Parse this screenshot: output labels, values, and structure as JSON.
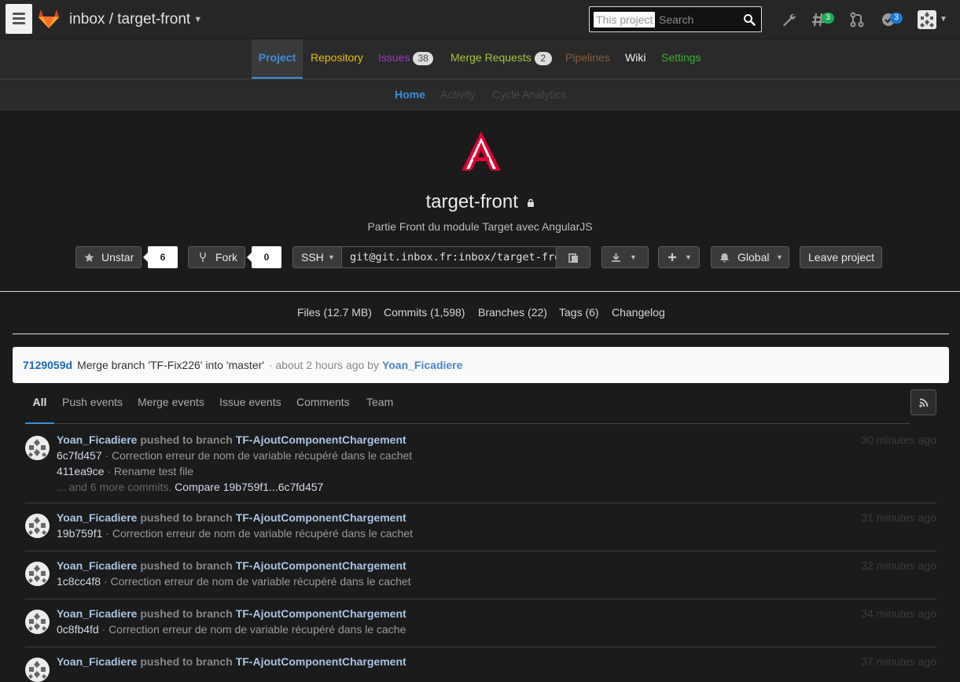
{
  "header": {
    "project_path": "inbox / target-front",
    "search_scope": "This project",
    "search_placeholder": "Search",
    "todos_count": "3",
    "issues_count": "3"
  },
  "nav": {
    "items": [
      {
        "label": "Project",
        "color": "#3b8fd9"
      },
      {
        "label": "Repository",
        "color": "#e5c100"
      },
      {
        "label": "Issues",
        "count": "38",
        "color": "#9f32d0"
      },
      {
        "label": "Merge Requests",
        "count": "2",
        "color": "#a4c639"
      },
      {
        "label": "Pipelines",
        "color": "#8b5a3c"
      },
      {
        "label": "Wiki",
        "color": "#f0f0f0"
      },
      {
        "label": "Settings",
        "color": "#3eae38"
      }
    ],
    "sub_items": [
      {
        "label": "Home",
        "color": "#3b8fd9"
      },
      {
        "label": "Activity",
        "color": "#4a4a4a"
      },
      {
        "label": "Cycle Analytics",
        "color": "#4a4a4a"
      }
    ]
  },
  "project": {
    "name": "target-front",
    "description": "Partie Front du module Target avec AngularJS",
    "star_label": "Unstar",
    "star_count": "6",
    "fork_label": "Fork",
    "fork_count": "0",
    "protocol": "SSH",
    "clone_url": "git@git.inbox.fr:inbox/target-front.git",
    "notification_label": "Global",
    "leave_label": "Leave project"
  },
  "stats": {
    "files": "Files (12.7 MB)",
    "commits": "Commits (1,598)",
    "branches": "Branches (22)",
    "tags": "Tags (6)",
    "changelog": "Changelog"
  },
  "last_commit": {
    "sha": "7129059d",
    "message": "Merge branch 'TF-Fix226' into 'master'",
    "meta": "· about 2 hours ago by",
    "author": "Yoan_Ficadiere"
  },
  "event_tabs": [
    "All",
    "Push events",
    "Merge events",
    "Issue events",
    "Comments",
    "Team"
  ],
  "events": [
    {
      "user": "Yoan_Ficadiere",
      "action": "pushed to branch",
      "branch": "TF-AjoutComponentChargement",
      "time": "30 minutes ago",
      "commits": [
        {
          "sha": "6c7fd457",
          "msg": "Correction erreur de nom de variable récupéré dans le cachet"
        },
        {
          "sha": "411ea9ce",
          "msg": "Rename test file"
        }
      ],
      "more": "... and 6 more commits.",
      "compare": "Compare 19b759f1...6c7fd457"
    },
    {
      "user": "Yoan_Ficadiere",
      "action": "pushed to branch",
      "branch": "TF-AjoutComponentChargement",
      "time": "31 minutes ago",
      "commits": [
        {
          "sha": "19b759f1",
          "msg": "Correction erreur de nom de variable récupéré dans le cachet"
        }
      ]
    },
    {
      "user": "Yoan_Ficadiere",
      "action": "pushed to branch",
      "branch": "TF-AjoutComponentChargement",
      "time": "32 minutes ago",
      "commits": [
        {
          "sha": "1c8cc4f8",
          "msg": "Correction erreur de nom de variable récupéré dans le cachet"
        }
      ]
    },
    {
      "user": "Yoan_Ficadiere",
      "action": "pushed to branch",
      "branch": "TF-AjoutComponentChargement",
      "time": "34 minutes ago",
      "commits": [
        {
          "sha": "0c8fb4fd",
          "msg": "Correction erreur de nom de variable récupéré dans le cache"
        }
      ]
    },
    {
      "user": "Yoan_Ficadiere",
      "action": "pushed to branch",
      "branch": "TF-AjoutComponentChargement",
      "time": "37 minutes ago",
      "commits": []
    }
  ]
}
